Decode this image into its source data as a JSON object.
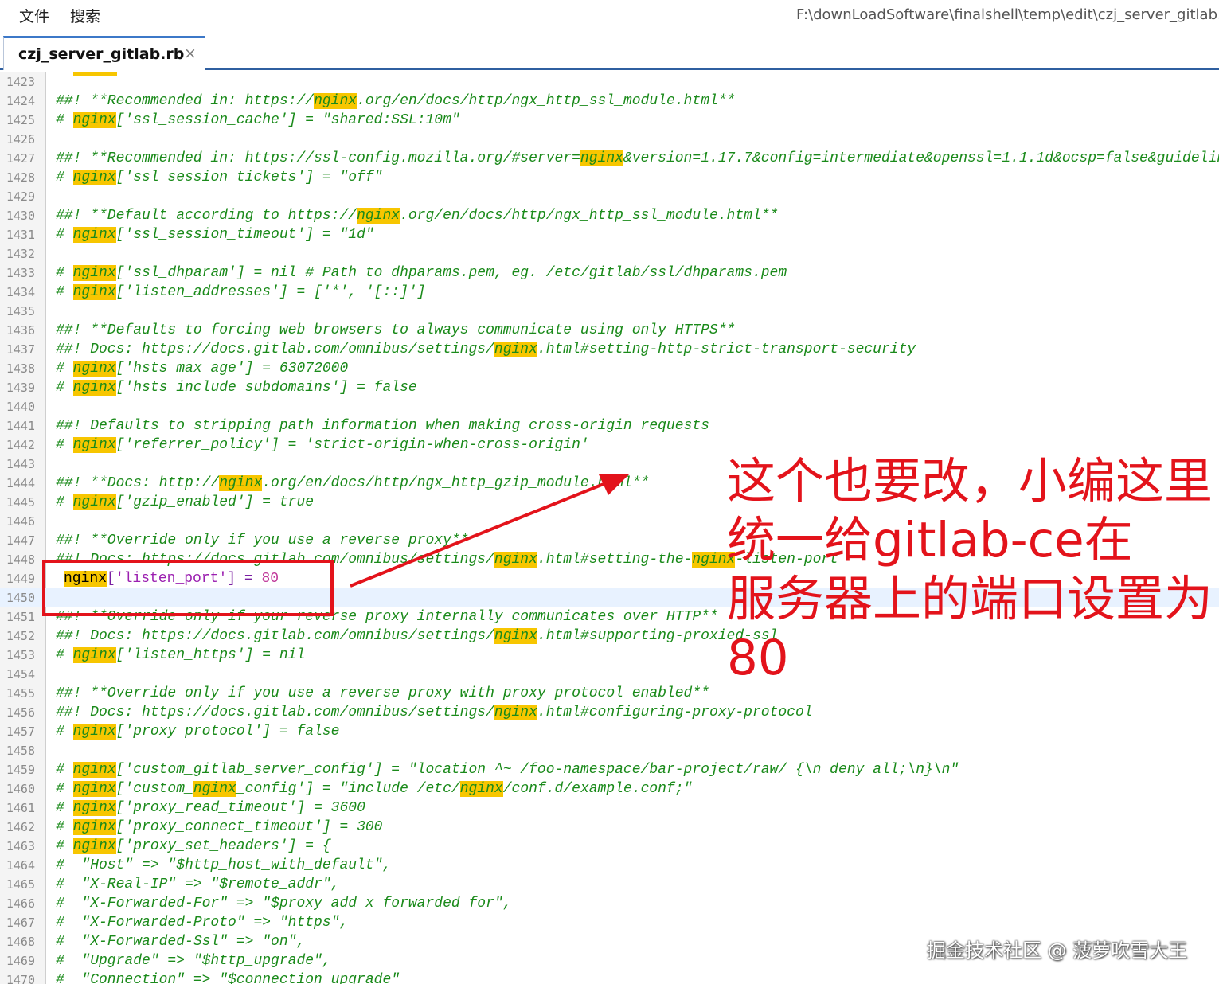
{
  "menubar": {
    "file_label": "文件",
    "search_label": "搜索",
    "file_path": "F:\\downLoadSoftware\\finalshell\\temp\\edit\\czj_server_gitlab.rb"
  },
  "tab": {
    "label": "czj_server_gitlab.rb",
    "close_glyph": "×"
  },
  "editor": {
    "highlight_term": "nginx",
    "current_line": 1450,
    "lines": [
      {
        "n": "1423",
        "t": ""
      },
      {
        "n": "1424",
        "t": "##! **Recommended in: https://nginx.org/en/docs/http/ngx_http_ssl_module.html**"
      },
      {
        "n": "1425",
        "t": "# nginx['ssl_session_cache'] = \"shared:SSL:10m\""
      },
      {
        "n": "1426",
        "t": ""
      },
      {
        "n": "1427",
        "t": "##! **Recommended in: https://ssl-config.mozilla.org/#server=nginx&version=1.17.7&config=intermediate&openssl=1.1.1d&ocsp=false&guideline"
      },
      {
        "n": "1428",
        "t": "# nginx['ssl_session_tickets'] = \"off\""
      },
      {
        "n": "1429",
        "t": ""
      },
      {
        "n": "1430",
        "t": "##! **Default according to https://nginx.org/en/docs/http/ngx_http_ssl_module.html**"
      },
      {
        "n": "1431",
        "t": "# nginx['ssl_session_timeout'] = \"1d\""
      },
      {
        "n": "1432",
        "t": ""
      },
      {
        "n": "1433",
        "t": "# nginx['ssl_dhparam'] = nil # Path to dhparams.pem, eg. /etc/gitlab/ssl/dhparams.pem"
      },
      {
        "n": "1434",
        "t": "# nginx['listen_addresses'] = ['*', '[::]']"
      },
      {
        "n": "1435",
        "t": ""
      },
      {
        "n": "1436",
        "t": "##! **Defaults to forcing web browsers to always communicate using only HTTPS**"
      },
      {
        "n": "1437",
        "t": "##! Docs: https://docs.gitlab.com/omnibus/settings/nginx.html#setting-http-strict-transport-security"
      },
      {
        "n": "1438",
        "t": "# nginx['hsts_max_age'] = 63072000"
      },
      {
        "n": "1439",
        "t": "# nginx['hsts_include_subdomains'] = false"
      },
      {
        "n": "1440",
        "t": ""
      },
      {
        "n": "1441",
        "t": "##! Defaults to stripping path information when making cross-origin requests"
      },
      {
        "n": "1442",
        "t": "# nginx['referrer_policy'] = 'strict-origin-when-cross-origin'"
      },
      {
        "n": "1443",
        "t": ""
      },
      {
        "n": "1444",
        "t": "##! **Docs: http://nginx.org/en/docs/http/ngx_http_gzip_module.html**"
      },
      {
        "n": "1445",
        "t": "# nginx['gzip_enabled'] = true"
      },
      {
        "n": "1446",
        "t": ""
      },
      {
        "n": "1447",
        "t": "##! **Override only if you use a reverse proxy**"
      },
      {
        "n": "1448",
        "t": "##! Docs: https://docs.gitlab.com/omnibus/settings/nginx.html#setting-the-nginx-listen-port"
      },
      {
        "n": "1449",
        "t": "nginx['listen_port'] = 80",
        "live": true
      },
      {
        "n": "1450",
        "t": ""
      },
      {
        "n": "1451",
        "t": "##! **Override only if your reverse proxy internally communicates over HTTP**"
      },
      {
        "n": "1452",
        "t": "##! Docs: https://docs.gitlab.com/omnibus/settings/nginx.html#supporting-proxied-ssl"
      },
      {
        "n": "1453",
        "t": "# nginx['listen_https'] = nil"
      },
      {
        "n": "1454",
        "t": ""
      },
      {
        "n": "1455",
        "t": "##! **Override only if you use a reverse proxy with proxy protocol enabled**"
      },
      {
        "n": "1456",
        "t": "##! Docs: https://docs.gitlab.com/omnibus/settings/nginx.html#configuring-proxy-protocol"
      },
      {
        "n": "1457",
        "t": "# nginx['proxy_protocol'] = false"
      },
      {
        "n": "1458",
        "t": ""
      },
      {
        "n": "1459",
        "t": "# nginx['custom_gitlab_server_config'] = \"location ^~ /foo-namespace/bar-project/raw/ {\\n deny all;\\n}\\n\""
      },
      {
        "n": "1460",
        "t": "# nginx['custom_nginx_config'] = \"include /etc/nginx/conf.d/example.conf;\""
      },
      {
        "n": "1461",
        "t": "# nginx['proxy_read_timeout'] = 3600"
      },
      {
        "n": "1462",
        "t": "# nginx['proxy_connect_timeout'] = 300"
      },
      {
        "n": "1463",
        "t": "# nginx['proxy_set_headers'] = {"
      },
      {
        "n": "1464",
        "t": "#  \"Host\" => \"$http_host_with_default\","
      },
      {
        "n": "1465",
        "t": "#  \"X-Real-IP\" => \"$remote_addr\","
      },
      {
        "n": "1466",
        "t": "#  \"X-Forwarded-For\" => \"$proxy_add_x_forwarded_for\","
      },
      {
        "n": "1467",
        "t": "#  \"X-Forwarded-Proto\" => \"https\","
      },
      {
        "n": "1468",
        "t": "#  \"X-Forwarded-Ssl\" => \"on\","
      },
      {
        "n": "1469",
        "t": "#  \"Upgrade\" => \"$http_upgrade\","
      },
      {
        "n": "1470",
        "t": "#  \"Connection\" => \"$connection_upgrade\""
      }
    ]
  },
  "annotation": {
    "line1": "这个也要改，小编这里",
    "line2": "统一给gitlab-ce在",
    "line3": "服务器上的端口设置为",
    "line4": "80",
    "color": "#e3131b"
  },
  "watermark": "掘金技术社区 @ 菠萝吹雪大王",
  "colors": {
    "highlight": "#f7c600",
    "comment": "#1a8a1a",
    "tab_accent": "#3c78c8"
  }
}
